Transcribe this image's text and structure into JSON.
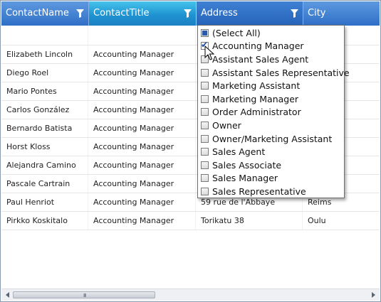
{
  "columns": [
    {
      "label": "ContactName"
    },
    {
      "label": "ContactTitle"
    },
    {
      "label": "Address"
    },
    {
      "label": "City"
    }
  ],
  "rows": [
    {
      "name": "Elizabeth Lincoln",
      "title": "Accounting Manager",
      "address": "",
      "city": ""
    },
    {
      "name": "Diego Roel",
      "title": "Accounting Manager",
      "address": "",
      "city": ""
    },
    {
      "name": "Mario Pontes",
      "title": "Accounting Manager",
      "address": "",
      "city": "eiro"
    },
    {
      "name": "Carlos González",
      "title": "Accounting Manager",
      "address": "",
      "city": "eto"
    },
    {
      "name": "Bernardo Batista",
      "title": "Accounting Manager",
      "address": "",
      "city": "eiro"
    },
    {
      "name": "Horst Kloss",
      "title": "Accounting Manager",
      "address": "",
      "city": "e"
    },
    {
      "name": "Alejandra Camino",
      "title": "Accounting Manager",
      "address": "",
      "city": ""
    },
    {
      "name": "Pascale Cartrain",
      "title": "Accounting Manager",
      "address": "",
      "city": ""
    },
    {
      "name": "Paul Henriot",
      "title": "Accounting Manager",
      "address": "59 rue de l'Abbaye",
      "city": "Reims"
    },
    {
      "name": "Pirkko Koskitalo",
      "title": "Accounting Manager",
      "address": "Torikatu 38",
      "city": "Oulu"
    }
  ],
  "filter_options": [
    {
      "label": "(Select All)",
      "state": "partial"
    },
    {
      "label": "Accounting Manager",
      "state": "checked"
    },
    {
      "label": "Assistant Sales Agent",
      "state": "unchecked"
    },
    {
      "label": "Assistant Sales Representative",
      "state": "unchecked"
    },
    {
      "label": "Marketing Assistant",
      "state": "unchecked"
    },
    {
      "label": "Marketing Manager",
      "state": "unchecked"
    },
    {
      "label": "Order Administrator",
      "state": "unchecked"
    },
    {
      "label": "Owner",
      "state": "unchecked"
    },
    {
      "label": "Owner/Marketing Assistant",
      "state": "unchecked"
    },
    {
      "label": "Sales Agent",
      "state": "unchecked"
    },
    {
      "label": "Sales Associate",
      "state": "unchecked"
    },
    {
      "label": "Sales Manager",
      "state": "unchecked"
    },
    {
      "label": "Sales Representative",
      "state": "unchecked"
    }
  ],
  "scrollbar": {
    "grip": "III"
  },
  "colors": {
    "header": "#3a7bd0",
    "active_header": "#1f94d2",
    "checkbox_fill": "#2b5aa8"
  }
}
